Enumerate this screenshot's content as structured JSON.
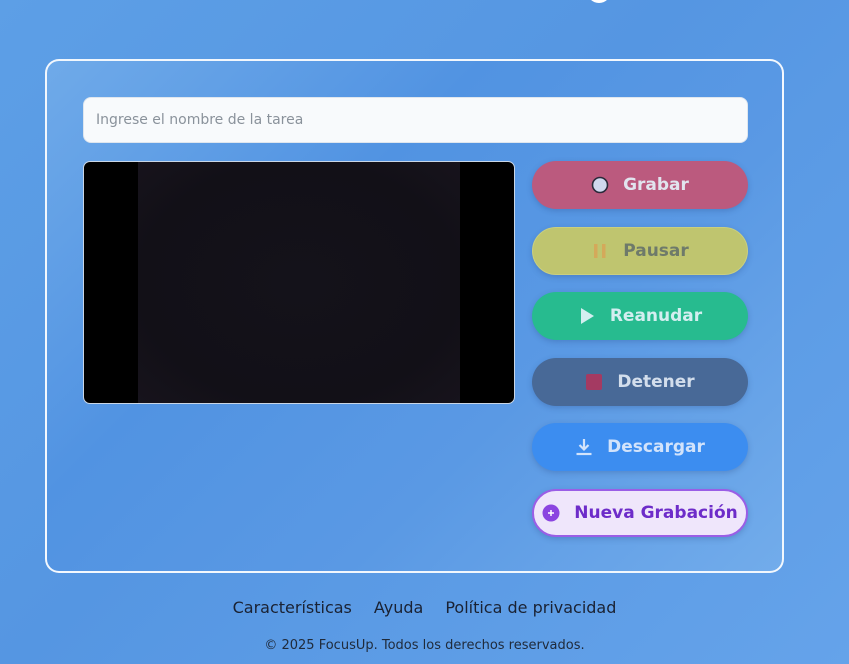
{
  "task": {
    "placeholder": "Ingrese el nombre de la tarea",
    "value": ""
  },
  "controls": {
    "record": {
      "label": "Grabar",
      "icon": "record-circle-icon",
      "color": "#bb5a7e"
    },
    "pause": {
      "label": "Pausar",
      "icon": "pause-icon",
      "color": "#bfc56f"
    },
    "resume": {
      "label": "Reanudar",
      "icon": "play-icon",
      "color": "#27bb8f"
    },
    "stop": {
      "label": "Detener",
      "icon": "stop-square-icon",
      "color": "#486997"
    },
    "download": {
      "label": "Descargar",
      "icon": "download-icon",
      "color": "#3c8df0"
    },
    "new_recording": {
      "label": "Nueva Grabación",
      "icon": "plus-circle-icon",
      "color": "#9a5ee6"
    }
  },
  "footer": {
    "links": [
      "Características",
      "Ayuda",
      "Política de privacidad"
    ],
    "copyright": "© 2025 FocusUp. Todos los derechos reservados."
  },
  "theme": {
    "background": "#5596e2",
    "card_border": "#ffffff"
  }
}
